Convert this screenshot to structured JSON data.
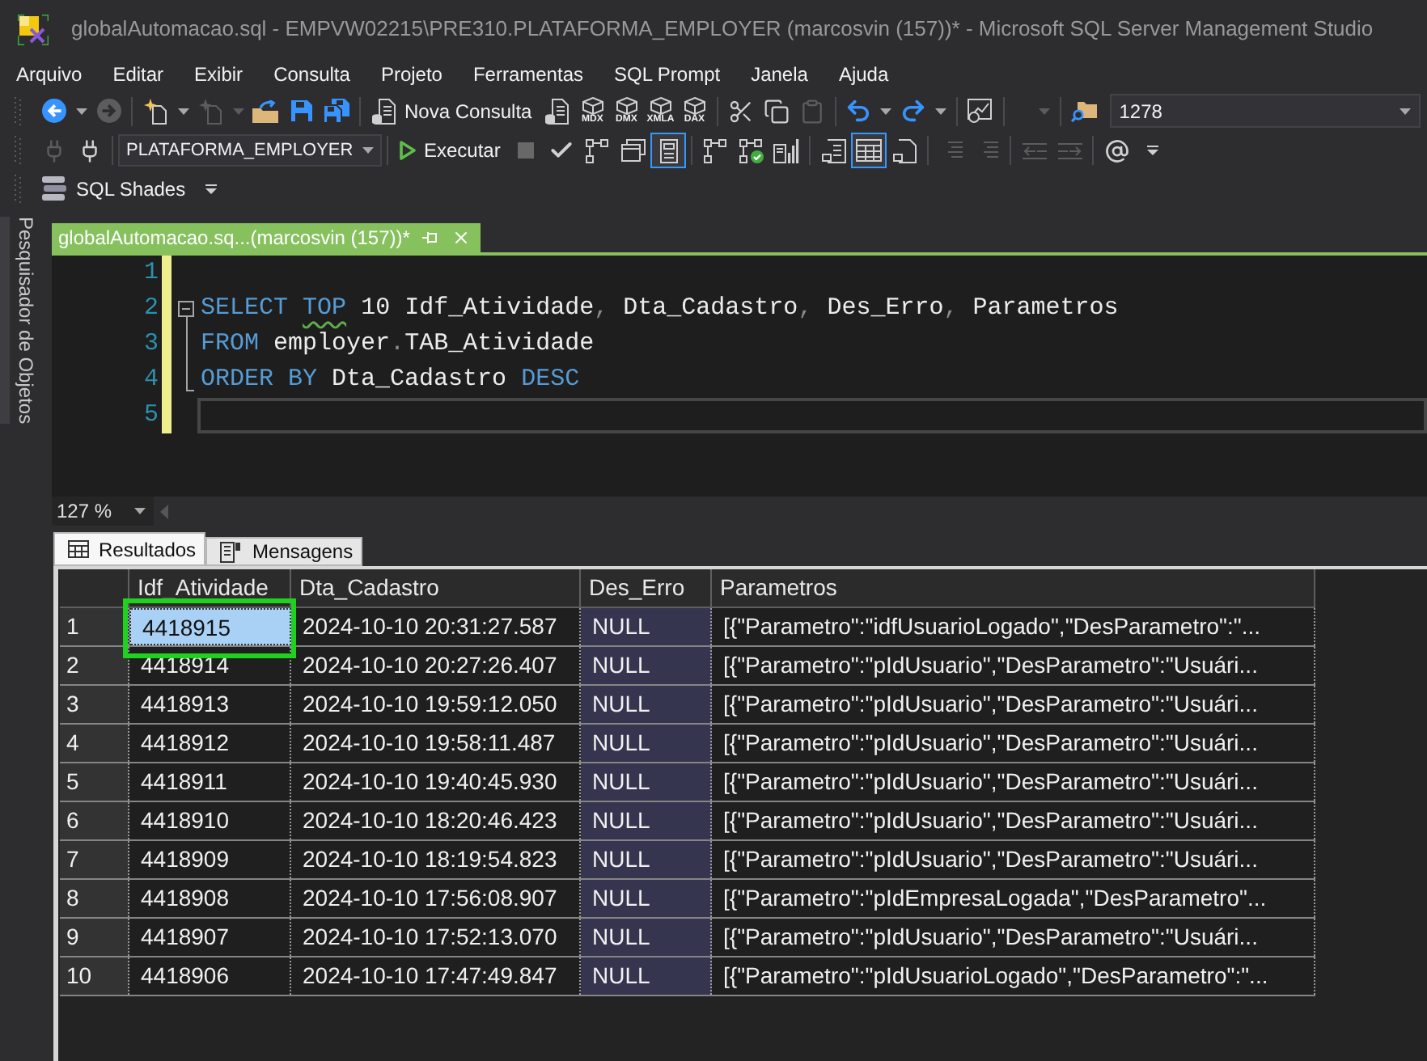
{
  "window": {
    "title": "globalAutomacao.sql - EMPVW02215\\PRE310.PLATAFORMA_EMPLOYER (marcosvin (157))* - Microsoft SQL Server Management Studio"
  },
  "menu": [
    "Arquivo",
    "Editar",
    "Exibir",
    "Consulta",
    "Projeto",
    "Ferramentas",
    "SQL Prompt",
    "Janela",
    "Ajuda"
  ],
  "toolbars": [
    {
      "groups": [
        [
          {
            "kind": "back",
            "disabled": false,
            "on": false
          },
          {
            "kind": "caret",
            "disabled": false,
            "on": false
          },
          {
            "kind": "forward",
            "disabled": true,
            "on": false
          }
        ],
        [
          {
            "kind": "new_project",
            "disabled": false,
            "on": false
          },
          {
            "kind": "caret",
            "disabled": false,
            "on": false
          },
          {
            "kind": "add_item",
            "disabled": true,
            "on": false
          },
          {
            "kind": "caret",
            "disabled": true,
            "on": false
          },
          {
            "kind": "open",
            "disabled": false,
            "on": false
          },
          {
            "kind": "save",
            "disabled": false,
            "on": false
          },
          {
            "kind": "save_all",
            "disabled": false,
            "on": false
          }
        ],
        [
          {
            "kind": "new_query",
            "label": "Nova Consulta",
            "disabled": false,
            "on": false
          },
          {
            "kind": "db_query",
            "disabled": false,
            "on": false
          },
          {
            "kind": "cube",
            "label": "MDX",
            "disabled": false,
            "on": false
          },
          {
            "kind": "cube",
            "label": "DMX",
            "disabled": false,
            "on": false
          },
          {
            "kind": "cube",
            "label": "XMLA",
            "disabled": false,
            "on": false
          },
          {
            "kind": "cube",
            "label": "DAX",
            "disabled": false,
            "on": false
          }
        ],
        [
          {
            "kind": "cut",
            "disabled": false,
            "on": false
          },
          {
            "kind": "copy",
            "disabled": false,
            "on": false
          },
          {
            "kind": "paste",
            "disabled": true,
            "on": false
          }
        ],
        [
          {
            "kind": "undo",
            "disabled": false,
            "on": false
          },
          {
            "kind": "caret",
            "disabled": false,
            "on": false
          },
          {
            "kind": "redo",
            "disabled": false,
            "on": false
          },
          {
            "kind": "caret",
            "disabled": false,
            "on": false
          }
        ],
        [
          {
            "kind": "monitor",
            "disabled": false,
            "on": false
          }
        ],
        [
          {
            "kind": "wide_caret",
            "disabled": true,
            "on": false
          }
        ],
        [
          {
            "kind": "find",
            "disabled": false,
            "on": false
          },
          {
            "kind": "search_combo",
            "value": "1278",
            "disabled": false,
            "on": false
          }
        ]
      ]
    },
    {
      "groups": [
        [
          {
            "kind": "plug",
            "disabled": true,
            "on": false
          },
          {
            "kind": "plug_change",
            "disabled": false,
            "on": false
          }
        ],
        [
          {
            "kind": "database_combo",
            "value": "PLATAFORMA_EMPLOYER",
            "disabled": false,
            "on": false
          }
        ],
        [
          {
            "kind": "execute",
            "label": "Executar",
            "disabled": false,
            "on": false
          },
          {
            "kind": "stop",
            "disabled": true,
            "on": false
          },
          {
            "kind": "check",
            "disabled": false,
            "on": false
          },
          {
            "kind": "plan",
            "disabled": false,
            "on": false
          },
          {
            "kind": "options",
            "disabled": false,
            "on": false
          },
          {
            "kind": "intellisense",
            "disabled": false,
            "on": true
          }
        ],
        [
          {
            "kind": "plan_actual",
            "disabled": false,
            "on": false
          },
          {
            "kind": "live_stats",
            "disabled": false,
            "on": false
          },
          {
            "kind": "client_stats",
            "disabled": false,
            "on": false
          }
        ],
        [
          {
            "kind": "results_text",
            "disabled": false,
            "on": false
          },
          {
            "kind": "results_grid",
            "disabled": false,
            "on": true
          },
          {
            "kind": "results_file",
            "disabled": false,
            "on": false
          }
        ],
        [
          {
            "kind": "comment",
            "disabled": true,
            "on": false
          },
          {
            "kind": "uncomment",
            "disabled": true,
            "on": false
          }
        ],
        [
          {
            "kind": "outdent",
            "disabled": true,
            "on": false
          },
          {
            "kind": "indent",
            "disabled": true,
            "on": false
          }
        ],
        [
          {
            "kind": "template",
            "disabled": false,
            "on": false
          },
          {
            "kind": "overflow",
            "disabled": false,
            "on": false
          }
        ]
      ]
    },
    {
      "groups": [
        [
          {
            "kind": "sql_shades",
            "label": "SQL Shades",
            "disabled": false,
            "on": false
          },
          {
            "kind": "overflow",
            "disabled": false,
            "on": false
          }
        ]
      ]
    }
  ],
  "side_tabs": [
    {
      "label": "Pesquisador de Objetos"
    }
  ],
  "document_tabs": [
    {
      "title": "globalAutomacao.sq...(marcosvin (157))*",
      "selected": true
    }
  ],
  "editor": {
    "fold_expanded": true,
    "zoom": "127 %",
    "lines": [
      {
        "number": "1",
        "kind": "plain",
        "changed": true,
        "current": false
      },
      {
        "number": "2",
        "kind": "fold_start",
        "changed": true,
        "current": false,
        "tokens": [
          {
            "text": "SELECT",
            "kind": "keyword",
            "squiggle": false
          },
          {
            "text": " TOP",
            "kind": "keyword",
            "squiggle": true
          },
          {
            "text": " 10",
            "kind": "plain",
            "squiggle": false
          },
          {
            "text": " Idf_Atividade",
            "kind": "plain",
            "squiggle": false
          },
          {
            "text": ",",
            "kind": "punct",
            "squiggle": false
          },
          {
            "text": " Dta_Cadastro",
            "kind": "plain",
            "squiggle": false
          },
          {
            "text": ",",
            "kind": "punct",
            "squiggle": false
          },
          {
            "text": " Des_Erro",
            "kind": "plain",
            "squiggle": false
          },
          {
            "text": ",",
            "kind": "punct",
            "squiggle": false
          },
          {
            "text": " Parametros",
            "kind": "plain",
            "squiggle": false
          }
        ]
      },
      {
        "number": "3",
        "kind": "fold_body",
        "changed": true,
        "current": false,
        "tokens": [
          {
            "text": "FROM",
            "kind": "keyword",
            "squiggle": false
          },
          {
            "text": " employer",
            "kind": "plain",
            "squiggle": false
          },
          {
            "text": ".",
            "kind": "punct",
            "squiggle": false
          },
          {
            "text": "TAB_Atividade",
            "kind": "plain",
            "squiggle": false
          }
        ]
      },
      {
        "number": "4",
        "kind": "fold_end",
        "changed": true,
        "current": false,
        "tokens": [
          {
            "text": "ORDER BY",
            "kind": "keyword",
            "squiggle": false
          },
          {
            "text": " Dta_Cadastro",
            "kind": "plain",
            "squiggle": false
          },
          {
            "text": " DESC",
            "kind": "keyword",
            "squiggle": false
          }
        ]
      },
      {
        "number": "5",
        "kind": "plain",
        "changed": true,
        "current": true
      }
    ]
  },
  "results": {
    "tabs": [
      {
        "label": "Resultados",
        "kind": "grid",
        "selected": true
      },
      {
        "label": "Mensagens",
        "kind": "messages",
        "selected": false
      }
    ],
    "columns": [
      "Idf_Atividade",
      "Dta_Cadastro",
      "Des_Erro",
      "Parametros"
    ],
    "rows": [
      {
        "number": "1",
        "cells": [
          {
            "text": "4418915",
            "null": false,
            "selected": true
          },
          {
            "text": "2024-10-10 20:31:27.587",
            "null": false,
            "selected": false
          },
          {
            "text": "NULL",
            "null": true,
            "selected": false
          },
          {
            "text": "[{\"Parametro\":\"idfUsuarioLogado\",\"DesParametro\":\"...",
            "null": false,
            "selected": false
          }
        ]
      },
      {
        "number": "2",
        "cells": [
          {
            "text": "4418914",
            "null": false,
            "selected": false
          },
          {
            "text": "2024-10-10 20:27:26.407",
            "null": false,
            "selected": false
          },
          {
            "text": "NULL",
            "null": true,
            "selected": false
          },
          {
            "text": "[{\"Parametro\":\"pIdUsuario\",\"DesParametro\":\"Usuári...",
            "null": false,
            "selected": false
          }
        ]
      },
      {
        "number": "3",
        "cells": [
          {
            "text": "4418913",
            "null": false,
            "selected": false
          },
          {
            "text": "2024-10-10 19:59:12.050",
            "null": false,
            "selected": false
          },
          {
            "text": "NULL",
            "null": true,
            "selected": false
          },
          {
            "text": "[{\"Parametro\":\"pIdUsuario\",\"DesParametro\":\"Usuári...",
            "null": false,
            "selected": false
          }
        ]
      },
      {
        "number": "4",
        "cells": [
          {
            "text": "4418912",
            "null": false,
            "selected": false
          },
          {
            "text": "2024-10-10 19:58:11.487",
            "null": false,
            "selected": false
          },
          {
            "text": "NULL",
            "null": true,
            "selected": false
          },
          {
            "text": "[{\"Parametro\":\"pIdUsuario\",\"DesParametro\":\"Usuári...",
            "null": false,
            "selected": false
          }
        ]
      },
      {
        "number": "5",
        "cells": [
          {
            "text": "4418911",
            "null": false,
            "selected": false
          },
          {
            "text": "2024-10-10 19:40:45.930",
            "null": false,
            "selected": false
          },
          {
            "text": "NULL",
            "null": true,
            "selected": false
          },
          {
            "text": "[{\"Parametro\":\"pIdUsuario\",\"DesParametro\":\"Usuári...",
            "null": false,
            "selected": false
          }
        ]
      },
      {
        "number": "6",
        "cells": [
          {
            "text": "4418910",
            "null": false,
            "selected": false
          },
          {
            "text": "2024-10-10 18:20:46.423",
            "null": false,
            "selected": false
          },
          {
            "text": "NULL",
            "null": true,
            "selected": false
          },
          {
            "text": "[{\"Parametro\":\"pIdUsuario\",\"DesParametro\":\"Usuári...",
            "null": false,
            "selected": false
          }
        ]
      },
      {
        "number": "7",
        "cells": [
          {
            "text": "4418909",
            "null": false,
            "selected": false
          },
          {
            "text": "2024-10-10 18:19:54.823",
            "null": false,
            "selected": false
          },
          {
            "text": "NULL",
            "null": true,
            "selected": false
          },
          {
            "text": "[{\"Parametro\":\"pIdUsuario\",\"DesParametro\":\"Usuári...",
            "null": false,
            "selected": false
          }
        ]
      },
      {
        "number": "8",
        "cells": [
          {
            "text": "4418908",
            "null": false,
            "selected": false
          },
          {
            "text": "2024-10-10 17:56:08.907",
            "null": false,
            "selected": false
          },
          {
            "text": "NULL",
            "null": true,
            "selected": false
          },
          {
            "text": "[{\"Parametro\":\"pIdEmpresaLogada\",\"DesParametro\"...",
            "null": false,
            "selected": false
          }
        ]
      },
      {
        "number": "9",
        "cells": [
          {
            "text": "4418907",
            "null": false,
            "selected": false
          },
          {
            "text": "2024-10-10 17:52:13.070",
            "null": false,
            "selected": false
          },
          {
            "text": "NULL",
            "null": true,
            "selected": false
          },
          {
            "text": "[{\"Parametro\":\"pIdUsuario\",\"DesParametro\":\"Usuári...",
            "null": false,
            "selected": false
          }
        ]
      },
      {
        "number": "10",
        "cells": [
          {
            "text": "4418906",
            "null": false,
            "selected": false
          },
          {
            "text": "2024-10-10 17:47:49.847",
            "null": false,
            "selected": false
          },
          {
            "text": "NULL",
            "null": true,
            "selected": false
          },
          {
            "text": "[{\"Parametro\":\"pIdUsuarioLogado\",\"DesParametro\":\"...",
            "null": false,
            "selected": false
          }
        ]
      }
    ]
  }
}
